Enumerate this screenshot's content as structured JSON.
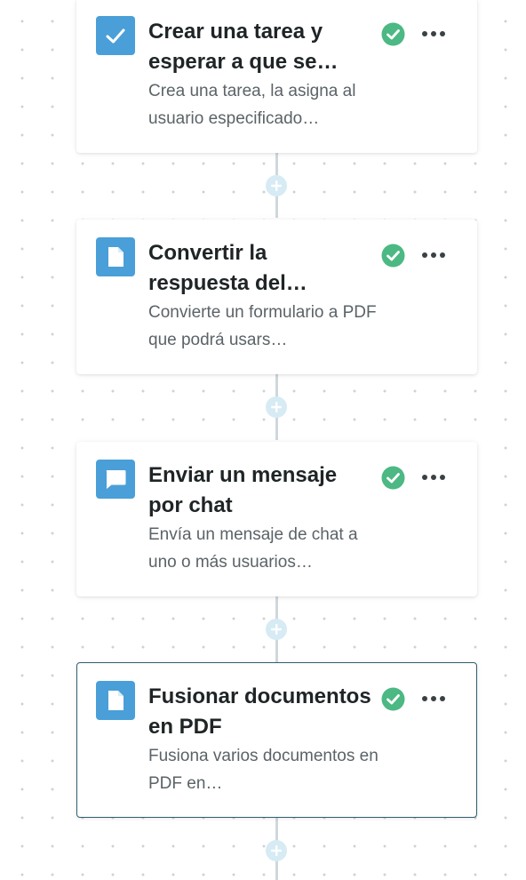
{
  "colors": {
    "icon_background": "#4a9fd8",
    "status_check": "#4cb883",
    "connector": "#cfd8dc",
    "add_button": "#d6ebf4",
    "selected_border": "#2f5e6e"
  },
  "steps": [
    {
      "icon": "checkbox-task-icon",
      "title": "Crear una tarea y esperar a que se…",
      "description": "Crea una tarea, la asigna al usuario especificado…",
      "status": "check-circle-icon",
      "selected": false
    },
    {
      "icon": "document-icon",
      "title": "Convertir la respuesta del…",
      "description": "Convierte un formulario a PDF que podrá usars…",
      "status": "check-circle-icon",
      "selected": false
    },
    {
      "icon": "chat-bubble-icon",
      "title": "Enviar un mensaje por chat",
      "description": "Envía un mensaje de chat a uno o más usuarios…",
      "status": "check-circle-icon",
      "selected": false
    },
    {
      "icon": "document-icon",
      "title": "Fusionar documentos en PDF",
      "description": "Fusiona varios documentos en PDF en…",
      "status": "check-circle-icon",
      "selected": true
    }
  ],
  "add_step_icon": "plus-icon",
  "more_icon": "more-horizontal-icon"
}
